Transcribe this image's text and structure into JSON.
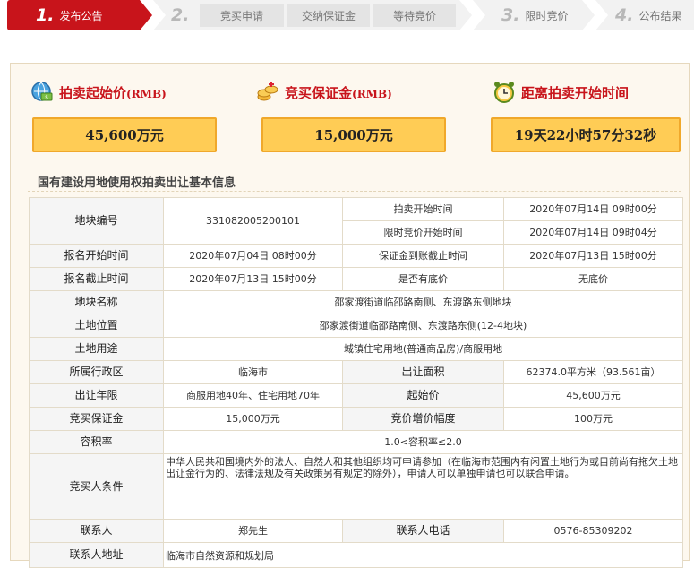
{
  "steps": {
    "step1": {
      "num": "1.",
      "label": "发布公告"
    },
    "step2": {
      "num": "2.",
      "sub": [
        "竞买申请",
        "交纳保证金",
        "等待竞价"
      ]
    },
    "step3": {
      "num": "3.",
      "label": "限时竞价"
    },
    "step4": {
      "num": "4.",
      "label": "公布结果"
    }
  },
  "summary": {
    "start_price": {
      "title": "拍卖起始价",
      "unit": "(RMB)",
      "value": "45,600万元"
    },
    "deposit": {
      "title": "竞买保证金",
      "unit": "(RMB)",
      "value": "15,000万元"
    },
    "countdown": {
      "title": "距离拍卖开始时间",
      "value": "19天22小时57分32秒"
    }
  },
  "section_title": "国有建设用地使用权拍卖出让基本信息",
  "info": {
    "plot_no_label": "地块编号",
    "plot_no": "331082005200101",
    "auction_start_label": "拍卖开始时间",
    "auction_start": "2020年07月14日 09时00分",
    "bid_start_label": "限时竞价开始时间",
    "bid_start": "2020年07月14日 09时04分",
    "reg_start_label": "报名开始时间",
    "reg_start": "2020年07月04日 08时00分",
    "deposit_deadline_label": "保证金到账截止时间",
    "deposit_deadline": "2020年07月13日 15时00分",
    "reg_end_label": "报名截止时间",
    "reg_end": "2020年07月13日 15时00分",
    "reserve_label": "是否有底价",
    "reserve": "无底价",
    "name_label": "地块名称",
    "name": "邵家渡街道临邵路南侧、东渡路东侧地块",
    "location_label": "土地位置",
    "location": "邵家渡街道临邵路南侧、东渡路东侧(12-4地块)",
    "use_label": "土地用途",
    "use": "城镇住宅用地(普通商品房)/商服用地",
    "district_label": "所属行政区",
    "district": "临海市",
    "area_label": "出让面积",
    "area": "62374.0平方米（93.561亩）",
    "term_label": "出让年限",
    "term": "商服用地40年、住宅用地70年",
    "start_price_label": "起始价",
    "start_price": "45,600万元",
    "deposit_label": "竞买保证金",
    "deposit": "15,000万元",
    "increment_label": "竞价增价幅度",
    "increment": "100万元",
    "far_label": "容积率",
    "far": "1.0<容积率≤2.0",
    "conditions_label": "竞买人条件",
    "conditions": "中华人民共和国境内外的法人、自然人和其他组织均可申请参加（在临海市范围内有闲置土地行为或目前尚有拖欠土地出让金行为的、法律法规及有关政策另有规定的除外），申请人可以单独申请也可以联合申请。",
    "contact_label": "联系人",
    "contact": "郑先生",
    "phone_label": "联系人电话",
    "phone": "0576-85309202",
    "address_label": "联系人地址",
    "address": "临海市自然资源和规划局"
  },
  "icons": {
    "start_price": "globe-money-icon",
    "deposit": "coins-icon",
    "countdown": "alarm-clock-icon"
  },
  "colors": {
    "accent": "#c8141b",
    "box_fill": "#ffcc55",
    "box_border": "#f0a82b"
  }
}
